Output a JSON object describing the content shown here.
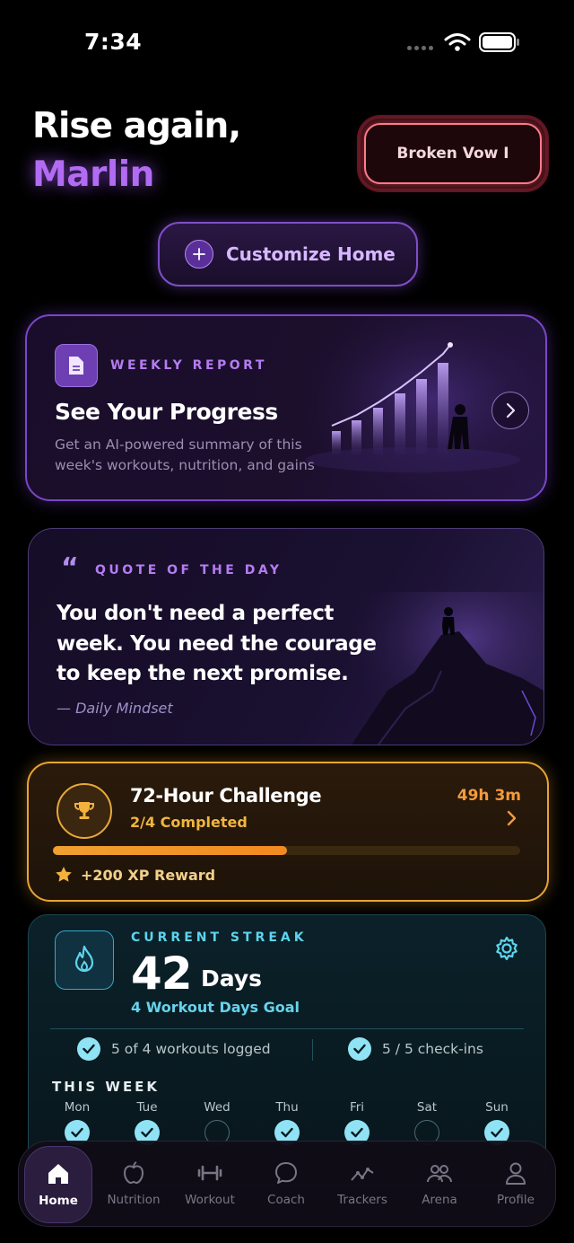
{
  "status_bar": {
    "time": "7:34"
  },
  "header": {
    "greeting_line1": "Rise again,",
    "greeting_name": "Marlin",
    "vow_button_label": "Broken Vow I",
    "customize_label": "Customize Home"
  },
  "weekly_report": {
    "eyebrow": "WEEKLY REPORT",
    "title": "See Your Progress",
    "description": "Get an AI-powered summary of this week's workouts, nutrition, and gains"
  },
  "quote": {
    "mark": "“",
    "eyebrow": "QUOTE OF THE DAY",
    "text": "You don't need a perfect week. You need the courage to keep the next promise.",
    "author": "— Daily Mindset"
  },
  "challenge": {
    "title": "72-Hour Challenge",
    "subtitle": "2/4 Completed",
    "time_left": "49h 3m",
    "progress": 0.5,
    "reward": "+200 XP Reward"
  },
  "streak": {
    "eyebrow": "CURRENT STREAK",
    "count": "42",
    "unit": "Days",
    "goal": "4 Workout Days Goal",
    "workouts_logged": "5 of 4 workouts logged",
    "checkins": "5 / 5 check-ins",
    "week_label": "THIS WEEK",
    "days": [
      {
        "name": "Mon",
        "done": true
      },
      {
        "name": "Tue",
        "done": true
      },
      {
        "name": "Wed",
        "done": false
      },
      {
        "name": "Thu",
        "done": true
      },
      {
        "name": "Fri",
        "done": true
      },
      {
        "name": "Sat",
        "done": false
      },
      {
        "name": "Sun",
        "done": true
      }
    ]
  },
  "tabs": [
    {
      "label": "Home",
      "icon": "home-icon",
      "active": true
    },
    {
      "label": "Nutrition",
      "icon": "apple-icon",
      "active": false
    },
    {
      "label": "Workout",
      "icon": "dumbbell-icon",
      "active": false
    },
    {
      "label": "Coach",
      "icon": "chat-bubble-icon",
      "active": false
    },
    {
      "label": "Trackers",
      "icon": "trend-line-icon",
      "active": false
    },
    {
      "label": "Arena",
      "icon": "people-icon",
      "active": false
    },
    {
      "label": "Profile",
      "icon": "person-icon",
      "active": false
    }
  ],
  "colors": {
    "accent_purple": "#b26cf3",
    "challenge_orange": "#e8a432",
    "streak_cyan": "#5dd4ec"
  }
}
